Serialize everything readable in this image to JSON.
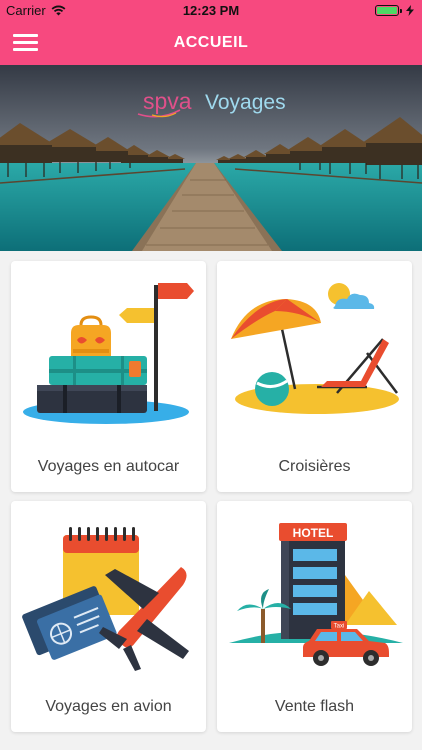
{
  "status_bar": {
    "carrier": "Carrier",
    "time": "12:23 PM"
  },
  "header": {
    "title": "ACCUEIL",
    "menu_icon": "hamburger-menu-icon"
  },
  "banner": {
    "logo_text_1": "spva",
    "logo_text_2": "Voyages"
  },
  "tiles": [
    {
      "label": "Voyages en autocar",
      "icon": "luggage-signpost-icon"
    },
    {
      "label": "Croisières",
      "icon": "beach-umbrella-chair-icon"
    },
    {
      "label": "Voyages en avion",
      "icon": "airplane-tickets-icon"
    },
    {
      "label": "Vente flash",
      "hotel_sign": "HOTEL",
      "taxi_sign": "Taxi",
      "icon": "hotel-taxi-icon"
    }
  ],
  "colors": {
    "brand": "#f7497f",
    "battery": "#4cd964"
  }
}
